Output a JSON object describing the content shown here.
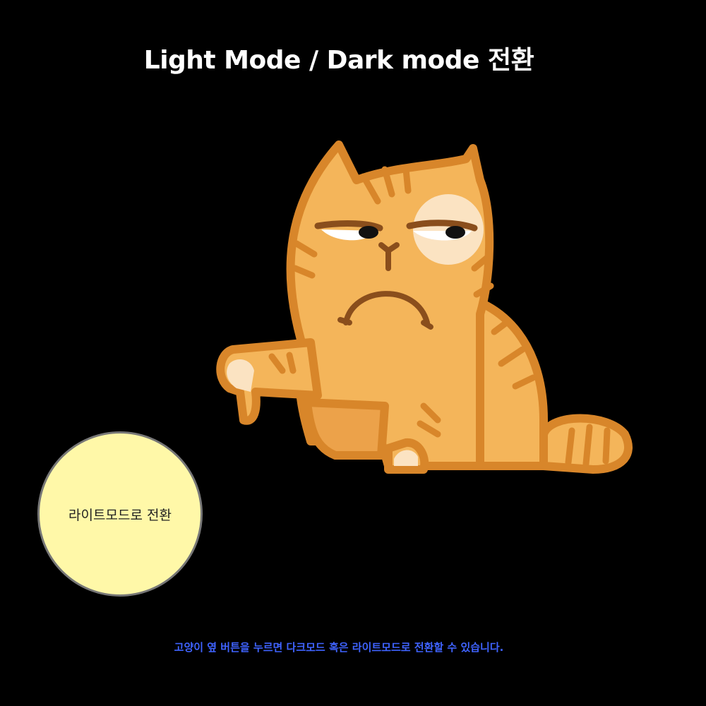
{
  "header": {
    "title": "Light Mode / Dark mode 전환"
  },
  "toggle": {
    "label": "라이트모드로 전환"
  },
  "footer": {
    "hint": "고양이 옆 버튼을 누르면 다크모드 혹은 라이트모드로 전환할 수 있습니다."
  },
  "colors": {
    "background": "#000000",
    "title": "#ffffff",
    "button_fill": "#fff8a8",
    "button_border": "#777777",
    "hint": "#3f63ff",
    "cat_body": "#f4b55a",
    "cat_outline": "#d8862a",
    "cat_dark": "#8a4e1c"
  },
  "illustration": {
    "icon": "grumpy-cat-illustration"
  }
}
